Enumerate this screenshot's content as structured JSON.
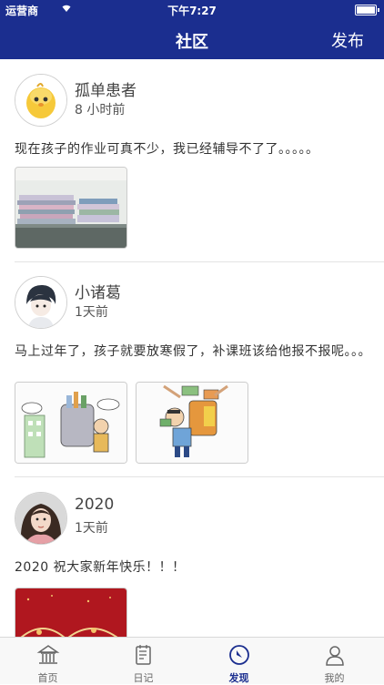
{
  "status_bar": {
    "carrier": "运营商",
    "time": "下午7:27"
  },
  "header": {
    "title": "社区",
    "publish_label": "发布"
  },
  "posts": [
    {
      "user": "孤单患者",
      "time": "8 小时前",
      "text": "现在孩子的作业可真不少，我已经辅导不了了。。。。。"
    },
    {
      "user": "小诸葛",
      "time": "1天前",
      "text": "马上过年了，孩子就要放寒假了，补课班该给他报不报呢。。。"
    },
    {
      "user": "2020",
      "time": "1天前",
      "text": "2020 祝大家新年快乐！！！"
    }
  ],
  "tabs": [
    {
      "label": "首页",
      "icon": "home-icon"
    },
    {
      "label": "日记",
      "icon": "diary-icon"
    },
    {
      "label": "发现",
      "icon": "compass-icon",
      "active": true
    },
    {
      "label": "我的",
      "icon": "profile-icon"
    }
  ],
  "colors": {
    "brand": "#1b2e8f",
    "tab_inactive": "#666666"
  }
}
